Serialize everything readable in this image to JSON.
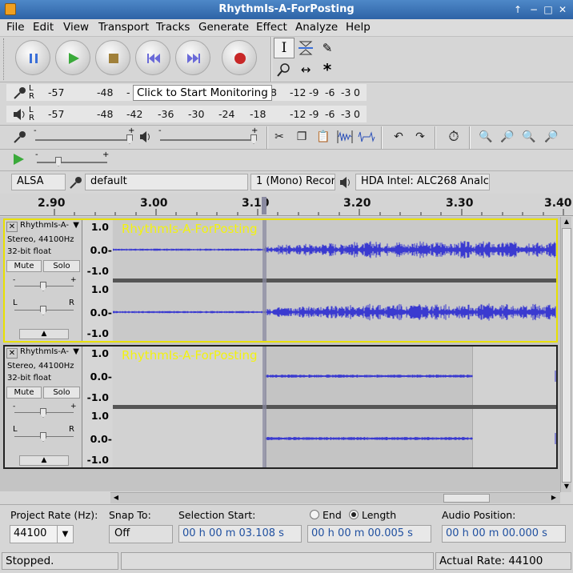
{
  "window": {
    "title": "RhythmIs-A-ForPosting",
    "controls": [
      "↑",
      "−",
      "□",
      "✕"
    ]
  },
  "menu": [
    "File",
    "Edit",
    "View",
    "Transport",
    "Tracks",
    "Generate",
    "Effect",
    "Analyze",
    "Help"
  ],
  "transport": {
    "buttons": [
      "pause-icon",
      "play-icon",
      "stop-icon",
      "skip-start-icon",
      "skip-end-icon",
      "record-icon"
    ]
  },
  "tools": [
    "selection-tool",
    "envelope-tool",
    "draw-tool",
    "zoom-tool",
    "time-shift-tool",
    "multi-tool"
  ],
  "meters": {
    "record_scale": [
      "-57",
      "-48",
      "-",
      "8",
      "-12",
      "-9",
      "-6",
      "-3",
      "0"
    ],
    "monitor_tip": "Click to Start Monitoring",
    "lr_top": "L",
    "lr_bottom": "R",
    "playback_scale": [
      "-57",
      "-48",
      "-42",
      "-36",
      "-30",
      "-24",
      "-18",
      "-12",
      "-9",
      "-6",
      "-3",
      "0"
    ]
  },
  "mixer": {
    "minus": "-",
    "plus": "+"
  },
  "device": {
    "host": "ALSA",
    "input": "default",
    "channels": "1 (Mono) Recor",
    "output": "HDA Intel: ALC268 Analc"
  },
  "timeline": {
    "labels": [
      "2.90",
      "3.00",
      "3.10",
      "3.20",
      "3.30",
      "3.40"
    ]
  },
  "tracks": [
    {
      "name": "RhythmIs-A-",
      "overlay_name": "RhythmIs-A-ForPosting",
      "format": "Stereo, 44100Hz",
      "bits": "32-bit float",
      "mute": "Mute",
      "solo": "Solo",
      "ruler": [
        "1.0",
        "0.0-",
        "-1.0",
        "1.0",
        "0.0-",
        "-1.0"
      ],
      "gain_minus": "-",
      "gain_plus": "+",
      "pan_left": "L",
      "pan_right": "R",
      "selected": true
    },
    {
      "name": "RhythmIs-A-",
      "overlay_name": "RhythmIs-A-ForPosting",
      "format": "Stereo, 44100Hz",
      "bits": "32-bit float",
      "mute": "Mute",
      "solo": "Solo",
      "ruler": [
        "1.0",
        "0.0-",
        "-1.0",
        "1.0",
        "0.0-",
        "-1.0"
      ],
      "gain_minus": "-",
      "gain_plus": "+",
      "pan_left": "L",
      "pan_right": "R",
      "selected": false
    }
  ],
  "selection_bar": {
    "project_rate_label": "Project Rate (Hz):",
    "project_rate": "44100",
    "snap_label": "Snap To:",
    "snap_value": "Off",
    "selection_start_label": "Selection Start:",
    "end_label": "End",
    "length_label": "Length",
    "length_selected": true,
    "audio_position_label": "Audio Position:",
    "selection_start": "00 h 00 m 03.108 s",
    "length": "00 h 00 m 00.005 s",
    "audio_position": "00 h 00 m 00.000 s"
  },
  "status": {
    "state": "Stopped.",
    "actual_rate": "Actual Rate: 44100"
  },
  "colors": {
    "titlebar": "#3a74b8",
    "waveform": "#3a3ad0",
    "track_name": "#f2f210",
    "selected_border": "#e8e000",
    "cursor": "#8a8aa0"
  }
}
